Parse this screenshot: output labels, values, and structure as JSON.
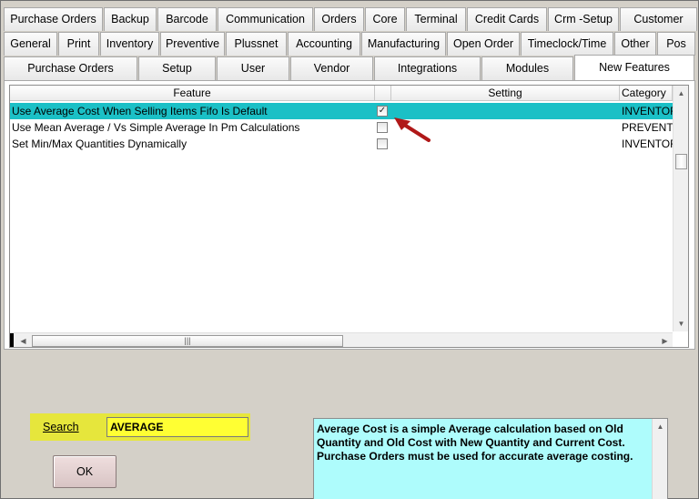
{
  "tabs_row1": [
    "Purchase Orders",
    "Backup",
    "Barcode",
    "Communication",
    "Orders",
    "Core",
    "Terminal",
    "Credit Cards",
    "Crm -Setup",
    "Customer"
  ],
  "tabs_row2": [
    "General",
    "Print",
    "Inventory",
    "Preventive",
    "Plussnet",
    "Accounting",
    "Manufacturing",
    "Open Order",
    "Timeclock/Time",
    "Other",
    "Pos"
  ],
  "tabs_row3": [
    "Purchase Orders",
    "Setup",
    "User",
    "Vendor",
    "Integrations",
    "Modules",
    "New Features"
  ],
  "active_tab": "New Features",
  "grid": {
    "columns": [
      "Feature",
      "Setting",
      "Category"
    ],
    "rows": [
      {
        "feature": "Use Average Cost When Selling Items Fifo Is Default",
        "checked": true,
        "check_glyph": "✓",
        "category": "INVENTORY",
        "selected": true
      },
      {
        "feature": "Use Mean Average / Vs Simple Average In Pm Calculations",
        "checked": false,
        "check_glyph": "",
        "category": "PREVENTIVE",
        "selected": false
      },
      {
        "feature": "Set Min/Max Quantities Dynamically",
        "checked": false,
        "check_glyph": "",
        "category": "INVENTORY",
        "selected": false
      }
    ]
  },
  "search": {
    "label": "Search",
    "value": "AVERAGE"
  },
  "ok_label": "OK",
  "description": "Average Cost is a simple Average calculation based on Old Quantity and Old Cost with New Quantity and Current Cost. Purchase Orders must be used for accurate average costing.",
  "colors": {
    "selected_row": "#1bc0c6",
    "search_highlight": "#e6e63c",
    "search_input": "#ffff33",
    "description_bg": "#aefcfc",
    "annotation_arrow": "#b01818"
  }
}
